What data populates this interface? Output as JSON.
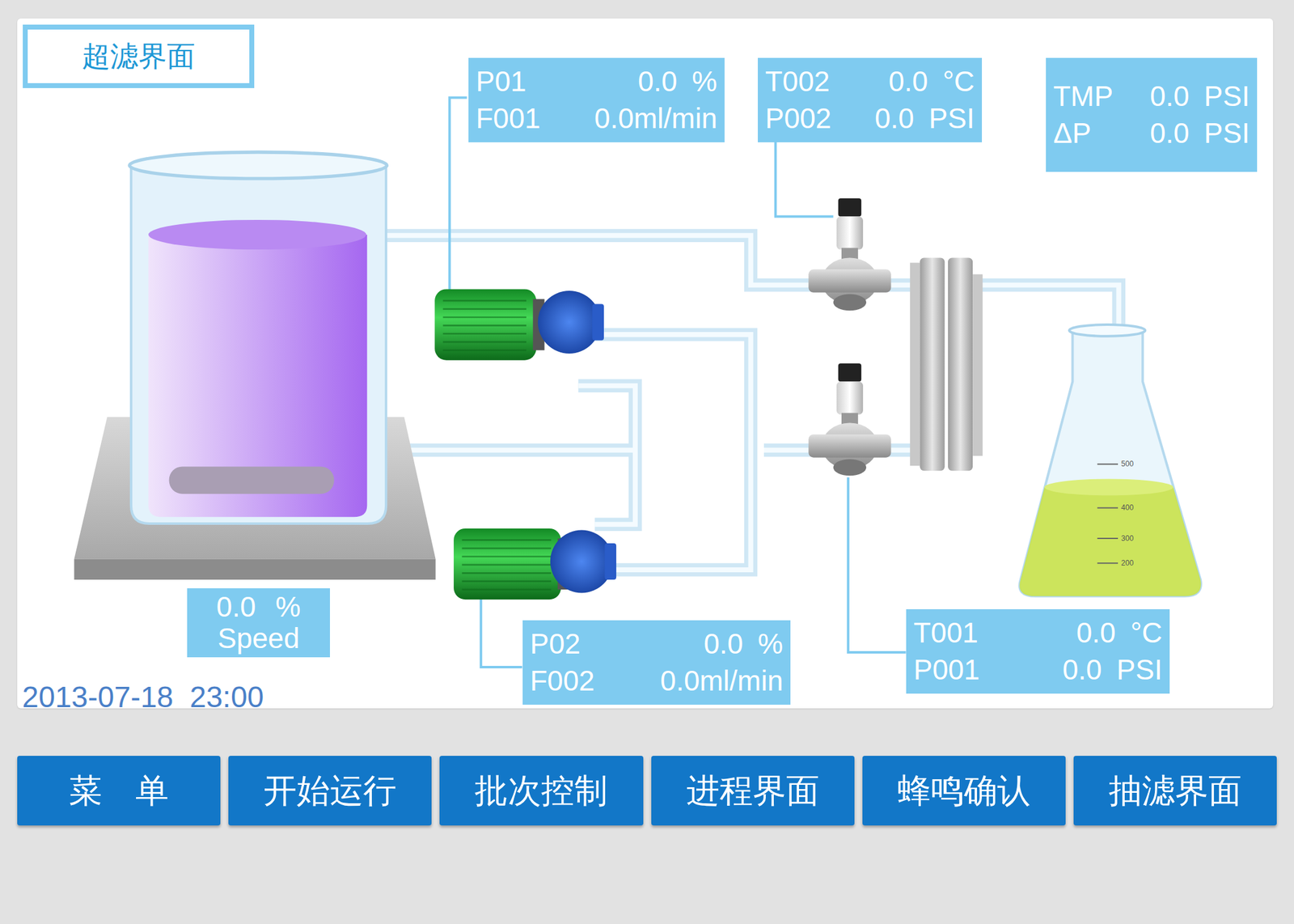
{
  "screen": {
    "title": "超滤界面",
    "datetime": "2013-07-18  23:00"
  },
  "readouts": [
    {
      "name": "pump-1",
      "rows": [
        {
          "label": "P01",
          "value": "0.0",
          "unit": "%"
        },
        {
          "label": "F001",
          "value": "0.0ml/min",
          "unit": ""
        }
      ]
    },
    {
      "name": "valve-outlet",
      "rows": [
        {
          "label": "T002",
          "value": "0.0",
          "unit": "°C"
        },
        {
          "label": "P002",
          "value": "0.0",
          "unit": "PSI"
        }
      ]
    },
    {
      "name": "membrane",
      "rows": [
        {
          "label": "TMP",
          "value": "0.0",
          "unit": "PSI"
        },
        {
          "label": "ΔP",
          "value": "0.0",
          "unit": "PSI"
        }
      ]
    },
    {
      "name": "pump-2",
      "rows": [
        {
          "label": "P02",
          "value": "0.0",
          "unit": "%"
        },
        {
          "label": "F002",
          "value": "0.0ml/min",
          "unit": ""
        }
      ]
    },
    {
      "name": "valve-inlet",
      "rows": [
        {
          "label": "T001",
          "value": "0.0",
          "unit": "°C"
        },
        {
          "label": "P001",
          "value": "0.0",
          "unit": "PSI"
        }
      ]
    }
  ],
  "stirrer": {
    "value": "0.0",
    "unit": "%",
    "label": "Speed"
  },
  "flask": {
    "graduations": [
      "500",
      "400",
      "300",
      "200"
    ]
  },
  "buttons": [
    "菜　单",
    "开始运行",
    "批次控制",
    "进程界面",
    "蜂鸣确认",
    "抽滤界面"
  ]
}
